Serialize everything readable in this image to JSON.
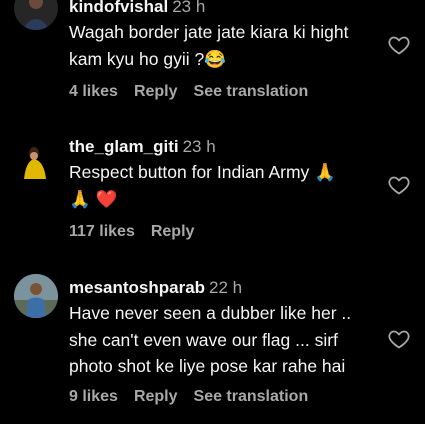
{
  "comments": [
    {
      "username": "kindofvishal",
      "time": "23 h",
      "text": "Wagah border jate jate kiara ki hight kam kyu ho gyii ?😂",
      "likes": "4 likes",
      "reply": "Reply",
      "translation": "See translation"
    },
    {
      "username": "the_glam_giti",
      "time": "23 h",
      "text": "Respect button for Indian Army 🙏 🙏 ❤️",
      "likes": "117 likes",
      "reply": "Reply"
    },
    {
      "username": "mesantoshparab",
      "time": "22 h",
      "text": "Have never seen a dubber like her .. she can't even wave our flag ... sirf photo shot ke liye pose kar rahe hai",
      "likes": "9 likes",
      "reply": "Reply",
      "translation": "See translation"
    }
  ],
  "colors": {
    "background": "#000000",
    "text": "#f5f5f5",
    "secondary": "#a8a8a8"
  },
  "icons": [
    "avatar",
    "heart-icon"
  ]
}
